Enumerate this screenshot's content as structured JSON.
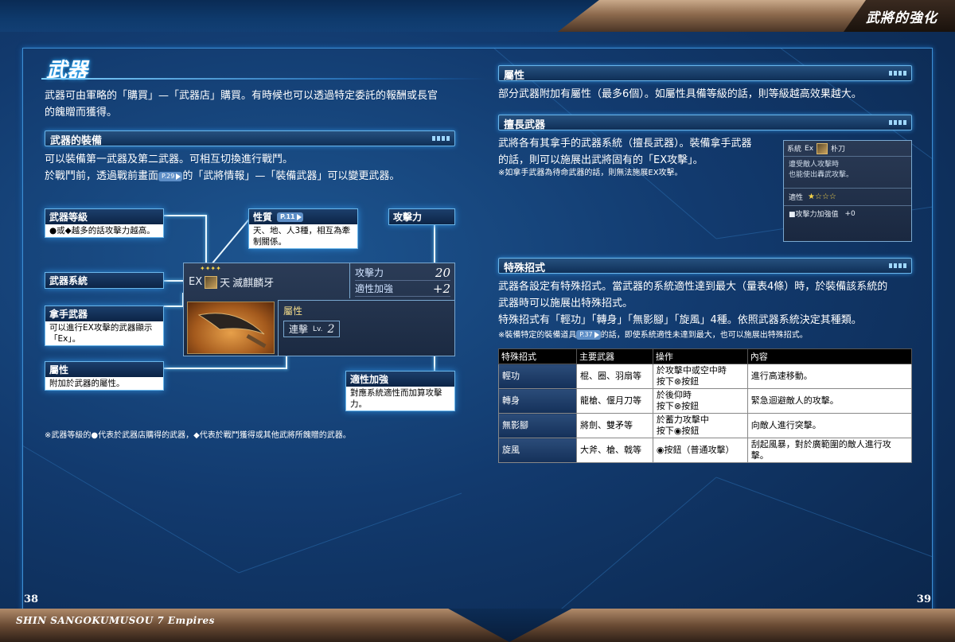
{
  "header": {
    "title": "武將的強化"
  },
  "footer": {
    "title": "SHIN SANGOKUMUSOU 7 Empires",
    "page_left": "38",
    "page_right": "39"
  },
  "left": {
    "heading": "武器",
    "intro": [
      "武器可由軍略的「購買」—「武器店」購買。有時候也可以透過特定委託的報酬或長官",
      "的餽贈而獲得。"
    ],
    "equip": {
      "label": "武器的裝備",
      "line1": "可以裝備第一武器及第二武器。可相互切換進行戰鬥。",
      "line2a": "於戰鬥前，透過戰前畫面",
      "line2ref": "P.29",
      "line2b": "的「武將情報」—「裝備武器」可以變更武器。"
    },
    "callouts": {
      "level": {
        "title": "武器等級",
        "body": "●或◆越多的話攻擊力越高。"
      },
      "nature": {
        "title": "性質",
        "ref": "P.11",
        "body": [
          "天、地、人3種，相互為牽",
          "制關係。"
        ]
      },
      "attack": {
        "title": "攻擊力"
      },
      "system": {
        "title": "武器系統"
      },
      "expert": {
        "title": "拿手武器",
        "body": [
          "可以進行EX攻擊的武器顯示",
          "「Ex」。"
        ]
      },
      "attribute": {
        "title": "屬性",
        "body": "附加於武器的屬性。"
      },
      "aptitude": {
        "title": "適性加強",
        "body": [
          "對應系統適性而加算攻擊",
          "力。"
        ]
      }
    },
    "weapon_panel": {
      "stars": "✦✦✦✦",
      "ex": "EX",
      "heaven": "天",
      "name": "滅麒麟牙",
      "attack_label": "攻擊力",
      "attack_value": "20",
      "aptitude_label": "適性加強",
      "aptitude_value": "+2",
      "attr_title": "屬性",
      "attr_name": "連擊",
      "attr_lv": "Lv.",
      "attr_level": "2"
    },
    "footnote": "※武器等級的●代表於武器店購得的武器，◆代表於戰鬥獲得或其他武將所餽贈的武器。"
  },
  "right": {
    "attr": {
      "label": "屬性",
      "text": "部分武器附加有屬性（最多6個）。如屬性具備等級的話，則等級越高效果越大。"
    },
    "expert": {
      "label": "擅長武器",
      "lines": [
        "武將各有其拿手的武器系統（擅長武器）。裝備拿手武器",
        "的話，則可以施展出武將固有的「EX攻擊」。"
      ],
      "note": "※如拿手武器為待命武器的話，則無法施展EX攻擊。"
    },
    "shot": {
      "system": "系統",
      "ex": "Ex",
      "weapon": "朴刀",
      "desc": [
        "遭受敵人攻擊時",
        "也能使出轟武攻擊。"
      ],
      "apt": "適性",
      "apt_stars": "★☆☆☆",
      "bonus": "■攻擊力加強值",
      "bonus_val": "+0"
    },
    "special": {
      "label": "特殊招式",
      "lines": [
        "武器各設定有特殊招式。當武器的系統適性達到最大（量表4條）時，於裝備該系統的",
        "武器時可以施展出特殊招式。",
        "特殊招式有「輕功」「轉身」「無影腳」「旋風」4種。依照武器系統決定其種類。"
      ],
      "note_a": "※裝備特定的裝備道具",
      "note_ref": "P.37",
      "note_b": "的話，即使系統適性未達到最大，也可以施展出特殊招式。"
    },
    "table": {
      "headers": [
        "特殊招式",
        "主要武器",
        "操作",
        "內容"
      ],
      "rows": [
        {
          "name": "輕功",
          "weapons": "棍、圈、羽扇等",
          "op": [
            "於攻擊中或空中時",
            "按下⊗按鈕"
          ],
          "desc": [
            "進行高速移動。"
          ]
        },
        {
          "name": "轉身",
          "weapons": "龍槍、偃月刀等",
          "op": [
            "於後仰時",
            "按下⊗按鈕"
          ],
          "desc": [
            "緊急迴避敵人的攻擊。"
          ]
        },
        {
          "name": "無影腳",
          "weapons": "將劍、雙矛等",
          "op": [
            "於蓄力攻擊中",
            "按下◉按鈕"
          ],
          "desc": [
            "向敵人進行突擊。"
          ]
        },
        {
          "name": "旋風",
          "weapons": "大斧、槍、戟等",
          "op": [
            "◉按鈕（普通攻擊）"
          ],
          "desc": [
            "刮起風暴，對於廣範圍的敵人進行攻",
            "擊。"
          ]
        }
      ]
    }
  }
}
